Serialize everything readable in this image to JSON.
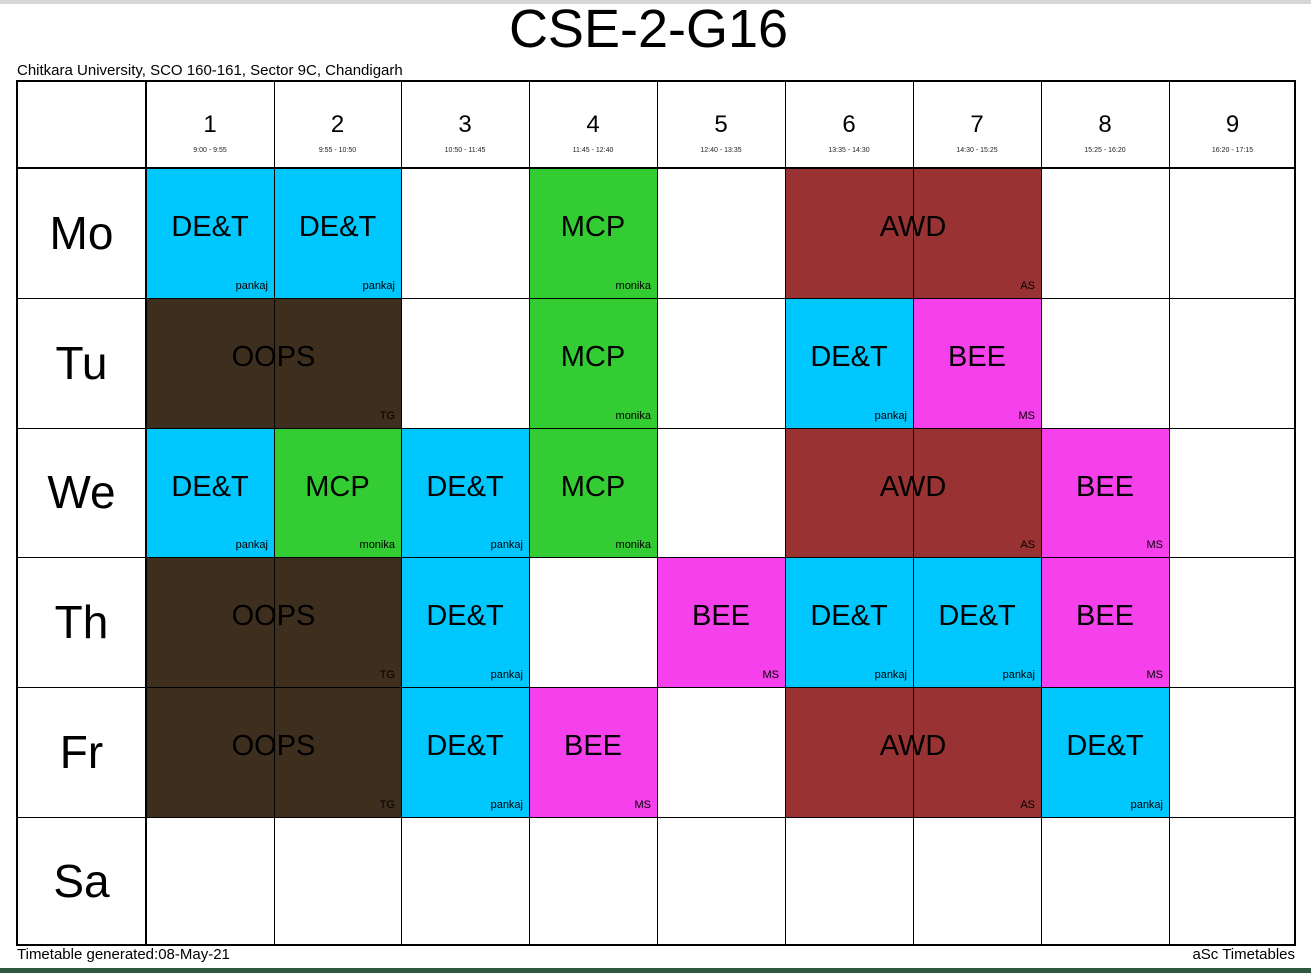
{
  "title": "CSE-2-G16",
  "school": "Chitkara University, SCO 160-161, Sector 9C, Chandigarh",
  "footer": {
    "generated": "Timetable generated:08-May-21",
    "brand": "aSc Timetables"
  },
  "periods": [
    {
      "num": "1",
      "time": "9:00 - 9:55"
    },
    {
      "num": "2",
      "time": "9:55 - 10:50"
    },
    {
      "num": "3",
      "time": "10:50 - 11:45"
    },
    {
      "num": "4",
      "time": "11:45 - 12:40"
    },
    {
      "num": "5",
      "time": "12:40 - 13:35"
    },
    {
      "num": "6",
      "time": "13:35 - 14:30"
    },
    {
      "num": "7",
      "time": "14:30 - 15:25"
    },
    {
      "num": "8",
      "time": "15:25 - 16:20"
    },
    {
      "num": "9",
      "time": "16:20 - 17:15"
    }
  ],
  "days": [
    "Mo",
    "Tu",
    "We",
    "Th",
    "Fr",
    "Sa"
  ],
  "colors": {
    "DE&T": "#00c8ff",
    "MCP": "#33cc33",
    "AWD": "#993333",
    "OOPS": "#3d2e1e",
    "BEE": "#f540ec"
  },
  "lessons": [
    {
      "day": 0,
      "start": 1,
      "span": 1,
      "subject": "DE&T",
      "teacher": "pankaj"
    },
    {
      "day": 0,
      "start": 2,
      "span": 1,
      "subject": "DE&T",
      "teacher": "pankaj"
    },
    {
      "day": 0,
      "start": 4,
      "span": 1,
      "subject": "MCP",
      "teacher": "monika"
    },
    {
      "day": 0,
      "start": 6,
      "span": 2,
      "subject": "AWD",
      "teacher": "AS"
    },
    {
      "day": 1,
      "start": 1,
      "span": 2,
      "subject": "OOPS",
      "teacher": "TG"
    },
    {
      "day": 1,
      "start": 4,
      "span": 1,
      "subject": "MCP",
      "teacher": "monika"
    },
    {
      "day": 1,
      "start": 6,
      "span": 1,
      "subject": "DE&T",
      "teacher": "pankaj"
    },
    {
      "day": 1,
      "start": 7,
      "span": 1,
      "subject": "BEE",
      "teacher": "MS"
    },
    {
      "day": 2,
      "start": 1,
      "span": 1,
      "subject": "DE&T",
      "teacher": "pankaj"
    },
    {
      "day": 2,
      "start": 2,
      "span": 1,
      "subject": "MCP",
      "teacher": "monika"
    },
    {
      "day": 2,
      "start": 3,
      "span": 1,
      "subject": "DE&T",
      "teacher": "pankaj"
    },
    {
      "day": 2,
      "start": 4,
      "span": 1,
      "subject": "MCP",
      "teacher": "monika"
    },
    {
      "day": 2,
      "start": 6,
      "span": 2,
      "subject": "AWD",
      "teacher": "AS"
    },
    {
      "day": 2,
      "start": 8,
      "span": 1,
      "subject": "BEE",
      "teacher": "MS"
    },
    {
      "day": 3,
      "start": 1,
      "span": 2,
      "subject": "OOPS",
      "teacher": "TG"
    },
    {
      "day": 3,
      "start": 3,
      "span": 1,
      "subject": "DE&T",
      "teacher": "pankaj"
    },
    {
      "day": 3,
      "start": 5,
      "span": 1,
      "subject": "BEE",
      "teacher": "MS"
    },
    {
      "day": 3,
      "start": 6,
      "span": 1,
      "subject": "DE&T",
      "teacher": "pankaj"
    },
    {
      "day": 3,
      "start": 7,
      "span": 1,
      "subject": "DE&T",
      "teacher": "pankaj"
    },
    {
      "day": 3,
      "start": 8,
      "span": 1,
      "subject": "BEE",
      "teacher": "MS"
    },
    {
      "day": 4,
      "start": 1,
      "span": 2,
      "subject": "OOPS",
      "teacher": "TG"
    },
    {
      "day": 4,
      "start": 3,
      "span": 1,
      "subject": "DE&T",
      "teacher": "pankaj"
    },
    {
      "day": 4,
      "start": 4,
      "span": 1,
      "subject": "BEE",
      "teacher": "MS"
    },
    {
      "day": 4,
      "start": 6,
      "span": 2,
      "subject": "AWD",
      "teacher": "AS"
    },
    {
      "day": 4,
      "start": 8,
      "span": 1,
      "subject": "DE&T",
      "teacher": "pankaj"
    }
  ]
}
